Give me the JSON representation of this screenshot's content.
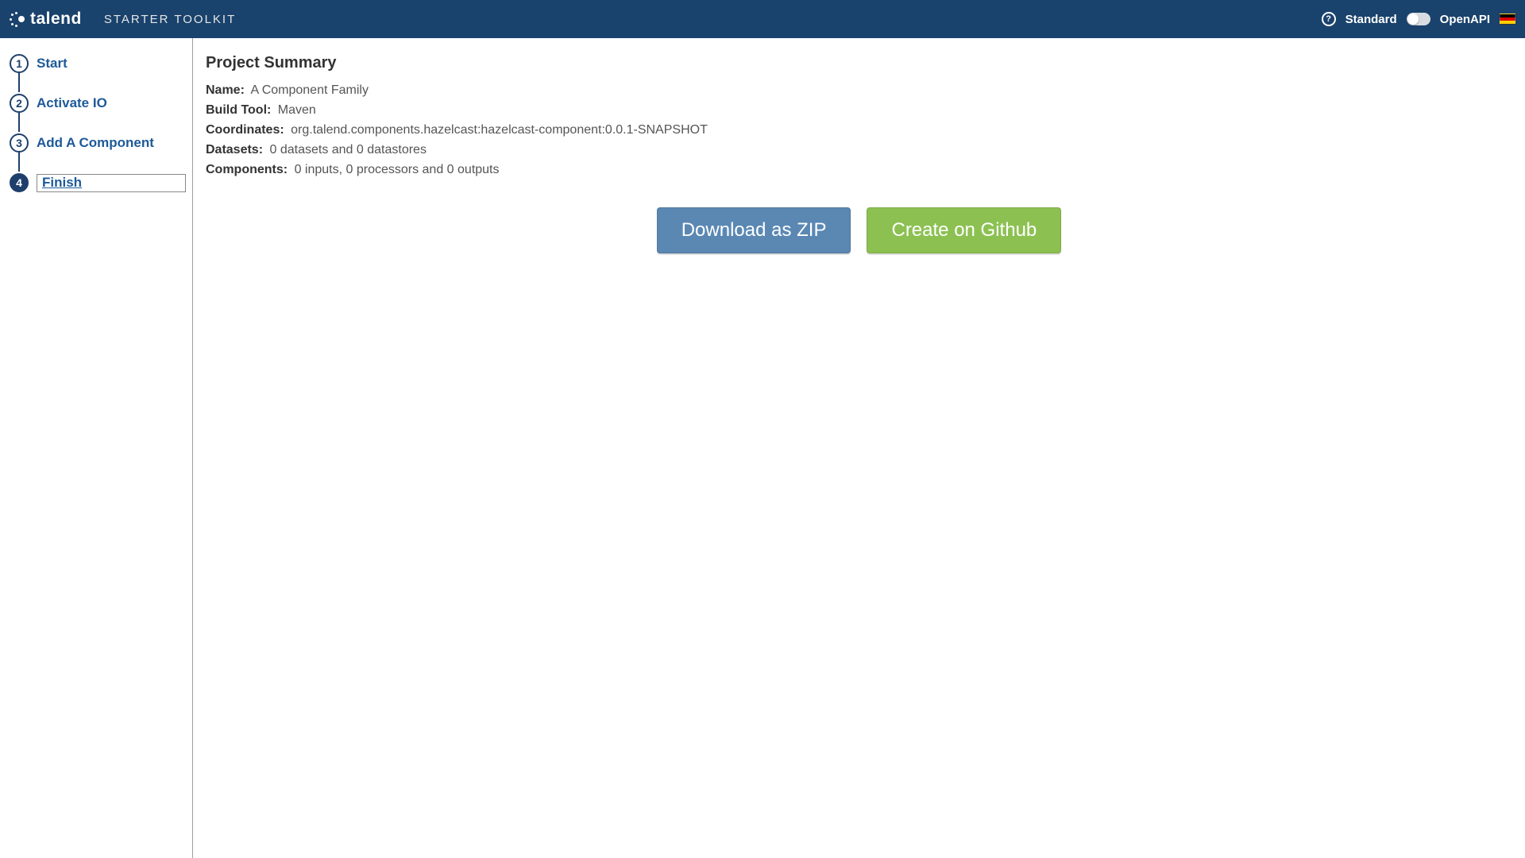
{
  "header": {
    "brand": "talend",
    "app_title": "STARTER TOOLKIT",
    "mode_standard": "Standard",
    "mode_openapi": "OpenAPI"
  },
  "sidebar": {
    "steps": [
      {
        "num": "1",
        "label": "Start"
      },
      {
        "num": "2",
        "label": "Activate IO"
      },
      {
        "num": "3",
        "label": "Add A Component"
      },
      {
        "num": "4",
        "label": "Finish"
      }
    ],
    "active_index": 3
  },
  "main": {
    "title": "Project Summary",
    "fields": {
      "name_label": "Name:",
      "name_value": "A Component Family",
      "build_label": "Build Tool:",
      "build_value": "Maven",
      "coord_label": "Coordinates:",
      "coord_value": "org.talend.components.hazelcast:hazelcast-component:0.0.1-SNAPSHOT",
      "datasets_label": "Datasets:",
      "datasets_value": "0 datasets and 0 datastores",
      "components_label": "Components:",
      "components_value": "0 inputs, 0 processors and 0 outputs"
    },
    "actions": {
      "download": "Download as ZIP",
      "github": "Create on Github"
    }
  }
}
